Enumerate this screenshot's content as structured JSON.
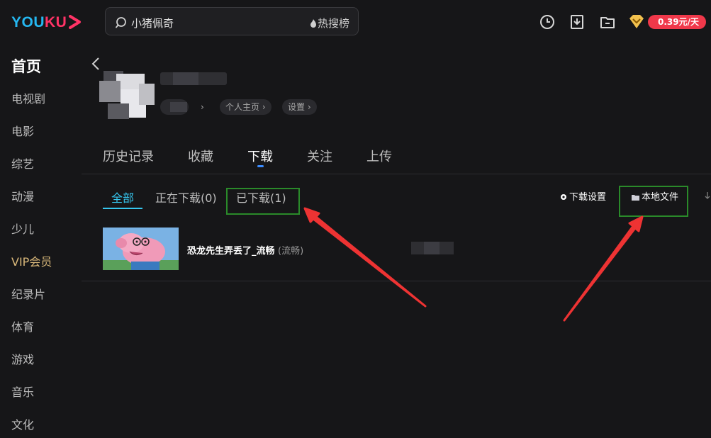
{
  "header": {
    "logo_you": "YOU",
    "logo_ku": "KU",
    "search_query": "小猪佩奇",
    "hot_label": "热搜榜",
    "vip_price": "0.39元/天"
  },
  "sidebar": {
    "items": [
      "首页",
      "电视剧",
      "电影",
      "综艺",
      "动漫",
      "少儿",
      "VIP会员",
      "纪录片",
      "体育",
      "游戏",
      "音乐",
      "文化"
    ]
  },
  "profile": {
    "homepage_label": "个人主页 ›",
    "settings_label": "设置 ›",
    "arrow_label": "›"
  },
  "tabs": [
    "历史记录",
    "收藏",
    "下载",
    "关注",
    "上传"
  ],
  "active_tab": "下载",
  "subtabs": [
    "全部",
    "正在下载(0)",
    "已下载(1)"
  ],
  "active_subtab": "全部",
  "actions": {
    "download_settings": "下载设置",
    "local_files": "本地文件"
  },
  "downloads": [
    {
      "title": "恐龙先生弄丢了_流畅",
      "quality": "(流畅)"
    }
  ],
  "colors": {
    "accent": "#36c7ef",
    "vip_gold": "#d9b87a",
    "badge_red": "#f0384a",
    "annotation_green": "#2a8a2a",
    "annotation_red": "#ee3333"
  }
}
